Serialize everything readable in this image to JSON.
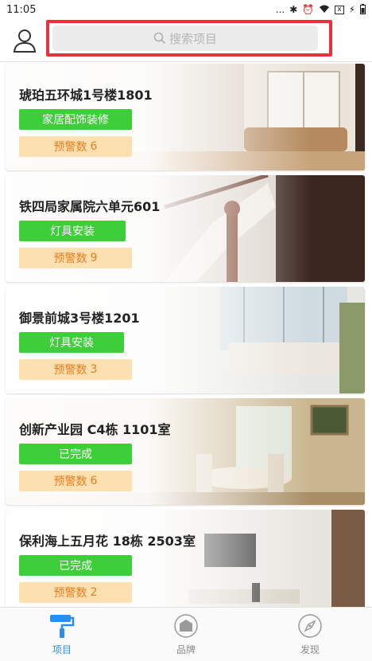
{
  "status_bar": {
    "time": "11:05",
    "signal_dots": "...",
    "battery_label": "x"
  },
  "header": {
    "search_placeholder": "搜索项目"
  },
  "projects": [
    {
      "title": "琥珀五环城1号楼1801",
      "stage": "家居配饰装修",
      "warning_label": "预警数",
      "warning_count": "6",
      "stage_color": "#3ece3a"
    },
    {
      "title": "铁四局家属院六单元601",
      "stage": "灯具安装",
      "warning_label": "预警数",
      "warning_count": "9",
      "stage_color": "#3ece3a"
    },
    {
      "title": "御景前城3号楼1201",
      "stage": "灯具安装",
      "warning_label": "预警数",
      "warning_count": "3",
      "stage_color": "#3ece3a"
    },
    {
      "title": "创新产业园 C4栋 1101室",
      "stage": "已完成",
      "warning_label": "预警数",
      "warning_count": "6",
      "stage_color": "#3ece3a"
    },
    {
      "title": "保利海上五月花 18栋 2503室",
      "stage": "已完成",
      "warning_label": "预警数",
      "warning_count": "2",
      "stage_color": "#3ece3a"
    }
  ],
  "tabs": [
    {
      "label": "项目",
      "icon": "paint-roller-icon",
      "active": true
    },
    {
      "label": "品牌",
      "icon": "house-icon",
      "active": false
    },
    {
      "label": "发现",
      "icon": "compass-icon",
      "active": false
    }
  ],
  "colors": {
    "accent": "#2d8cf0",
    "stage_green": "#3ece3a",
    "warning_bg": "#fde0b0",
    "warning_text": "#e67e22",
    "highlight_red": "#e8313a"
  }
}
